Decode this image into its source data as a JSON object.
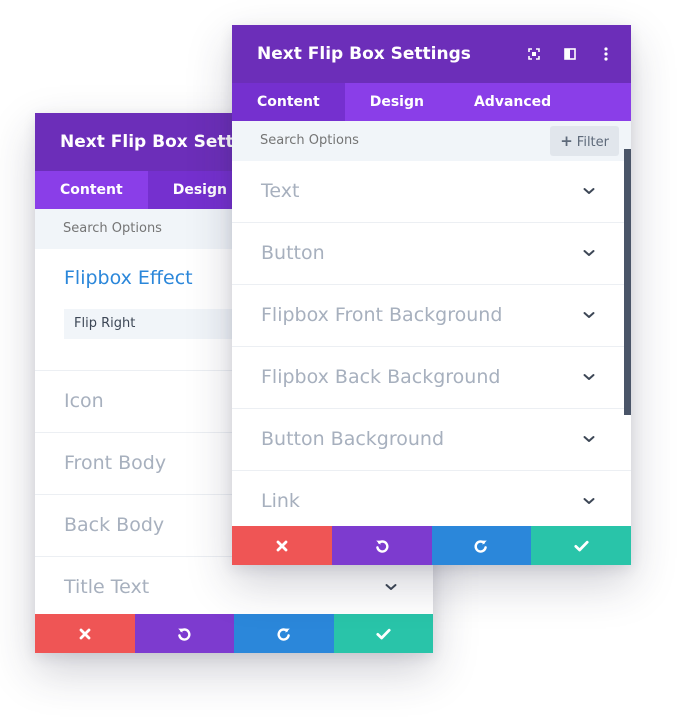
{
  "back_panel": {
    "title": "Next Flip Box Settings",
    "tabs": [
      {
        "label": "Content",
        "active": false
      },
      {
        "label": "Design",
        "active": true
      }
    ],
    "search": {
      "placeholder": "Search Options"
    },
    "effect": {
      "title": "Flipbox Effect",
      "selected": "Flip Right"
    },
    "sections": [
      {
        "label": "Icon"
      },
      {
        "label": "Front Body"
      },
      {
        "label": "Back Body"
      },
      {
        "label": "Title Text"
      }
    ]
  },
  "front_panel": {
    "title": "Next Flip Box Settings",
    "tabs": [
      {
        "label": "Content",
        "active": true
      },
      {
        "label": "Design",
        "active": false
      },
      {
        "label": "Advanced",
        "active": false
      }
    ],
    "search": {
      "placeholder": "Search Options",
      "filter_label": "Filter"
    },
    "sections": [
      {
        "label": "Text"
      },
      {
        "label": "Button"
      },
      {
        "label": "Flipbox Front Background"
      },
      {
        "label": "Flipbox Back Background"
      },
      {
        "label": "Button Background"
      },
      {
        "label": "Link"
      }
    ]
  },
  "icons": {
    "header": [
      "expand-icon",
      "split-view-icon",
      "more-vertical-icon"
    ],
    "chevron": "chevron-down-icon",
    "footer": [
      "close-icon",
      "undo-icon",
      "redo-icon",
      "check-icon"
    ],
    "filter": "plus-icon"
  },
  "colors": {
    "header": "#6c2eb9",
    "tabs": "#8a3ee8",
    "active_tab": "#7530cf",
    "cancel": "#ef5555",
    "undo": "#7d3bcf",
    "redo": "#2b87da",
    "save": "#29c4a9",
    "accent_text": "#2b87da"
  }
}
